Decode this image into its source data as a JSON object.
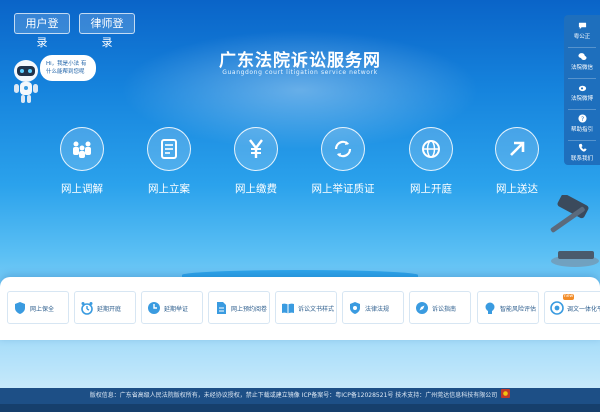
{
  "header": {
    "user_login": "用户登录",
    "lawyer_login": "律师登录",
    "title": "广东法院诉讼服务网",
    "subtitle": "Guangdong court litigation service network",
    "assistant_bubble": "Hi，我是小法 有什么能帮到您呢"
  },
  "right_bar": [
    {
      "label": "粤公正",
      "icon": "chat-icon"
    },
    {
      "label": "法院微信",
      "icon": "wechat-icon"
    },
    {
      "label": "法院微博",
      "icon": "weibo-icon"
    },
    {
      "label": "帮助指引",
      "icon": "help-icon"
    },
    {
      "label": "联系我们",
      "icon": "phone-icon"
    }
  ],
  "main_services": [
    {
      "label": "网上调解",
      "icon": "people-icon"
    },
    {
      "label": "网上立案",
      "icon": "document-icon"
    },
    {
      "label": "网上缴费",
      "icon": "yen-icon"
    },
    {
      "label": "网上举证质证",
      "icon": "exchange-icon"
    },
    {
      "label": "网上开庭",
      "icon": "globe-icon"
    },
    {
      "label": "网上送达",
      "icon": "send-arrow-icon"
    }
  ],
  "small_services": [
    {
      "label": "网上保全",
      "icon": "shield-icon"
    },
    {
      "label": "延期开庭",
      "icon": "alarm-clock-icon"
    },
    {
      "label": "延期举证",
      "icon": "clock-icon"
    },
    {
      "label": "网上预约阅卷",
      "icon": "file-icon"
    },
    {
      "label": "诉讼文书样式",
      "icon": "book-icon"
    },
    {
      "label": "法律法规",
      "icon": "badge-icon"
    },
    {
      "label": "诉讼指南",
      "icon": "compass-icon"
    },
    {
      "label": "智能风险评估",
      "icon": "lightbulb-icon"
    },
    {
      "label": "调文一体化平台",
      "icon": "platform-icon",
      "badge": "new"
    }
  ],
  "footer": {
    "text": "版权信息：广东省高级人民法院版权所有，未经协议授权，禁止下载或建立镜像 ICP备案号：粤ICP备12028521号 技术支持：广州莞达信息科技有限公司"
  },
  "colors": {
    "accent": "#1e6fbd",
    "footer": "#1d4f86",
    "icon_blue": "#3a9be0"
  }
}
